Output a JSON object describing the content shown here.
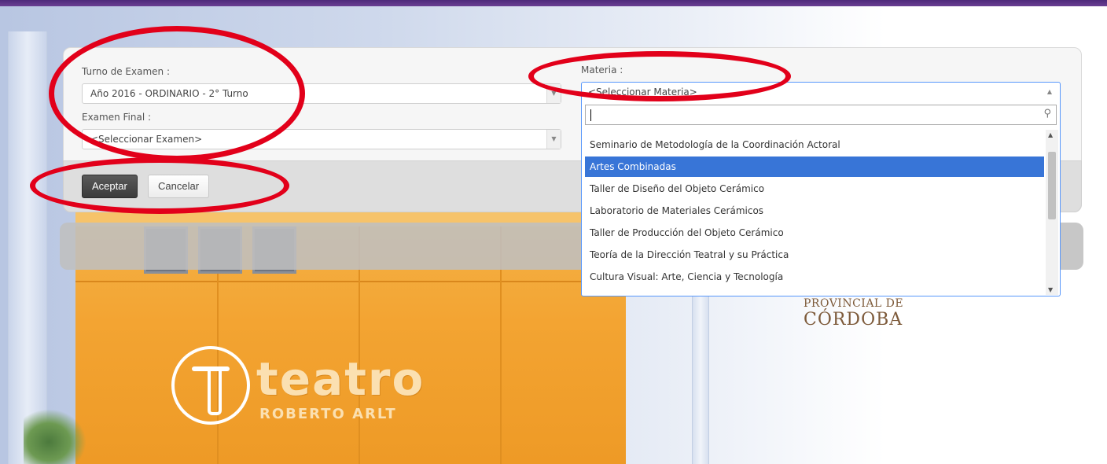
{
  "form": {
    "turno_label": "Turno de Examen :",
    "turno_value": "Año 2016 - ORDINARIO - 2° Turno",
    "examen_label": "Examen Final :",
    "examen_value": "<Seleccionar Examen>",
    "materia_label": "Materia :",
    "materia_value": "<Seleccionar Materia>",
    "aceptar": "Aceptar",
    "cancelar": "Cancelar"
  },
  "dropdown": {
    "search_value": "",
    "options": [
      "Seminario de Metodología de la Coordinación Actoral",
      "Artes Combinadas",
      "Taller de Diseño del Objeto Cerámico",
      "Laboratorio de Materiales Cerámicos",
      "Taller de Producción del Objeto Cerámico",
      "Teoría de la Dirección Teatral y su Práctica",
      "Cultura Visual: Arte, Ciencia y Tecnología"
    ],
    "selected": "Artes Combinadas"
  },
  "background": {
    "teatro": "teatro",
    "teatro_sub": "ROBERTO ARLT",
    "prov_line1": "PROVINCIAL DE",
    "prov_line2": "CÓRDOBA"
  },
  "colors": {
    "annotation": "#e2001a",
    "highlight": "#3875d7",
    "header_bar": "#5a3385"
  }
}
